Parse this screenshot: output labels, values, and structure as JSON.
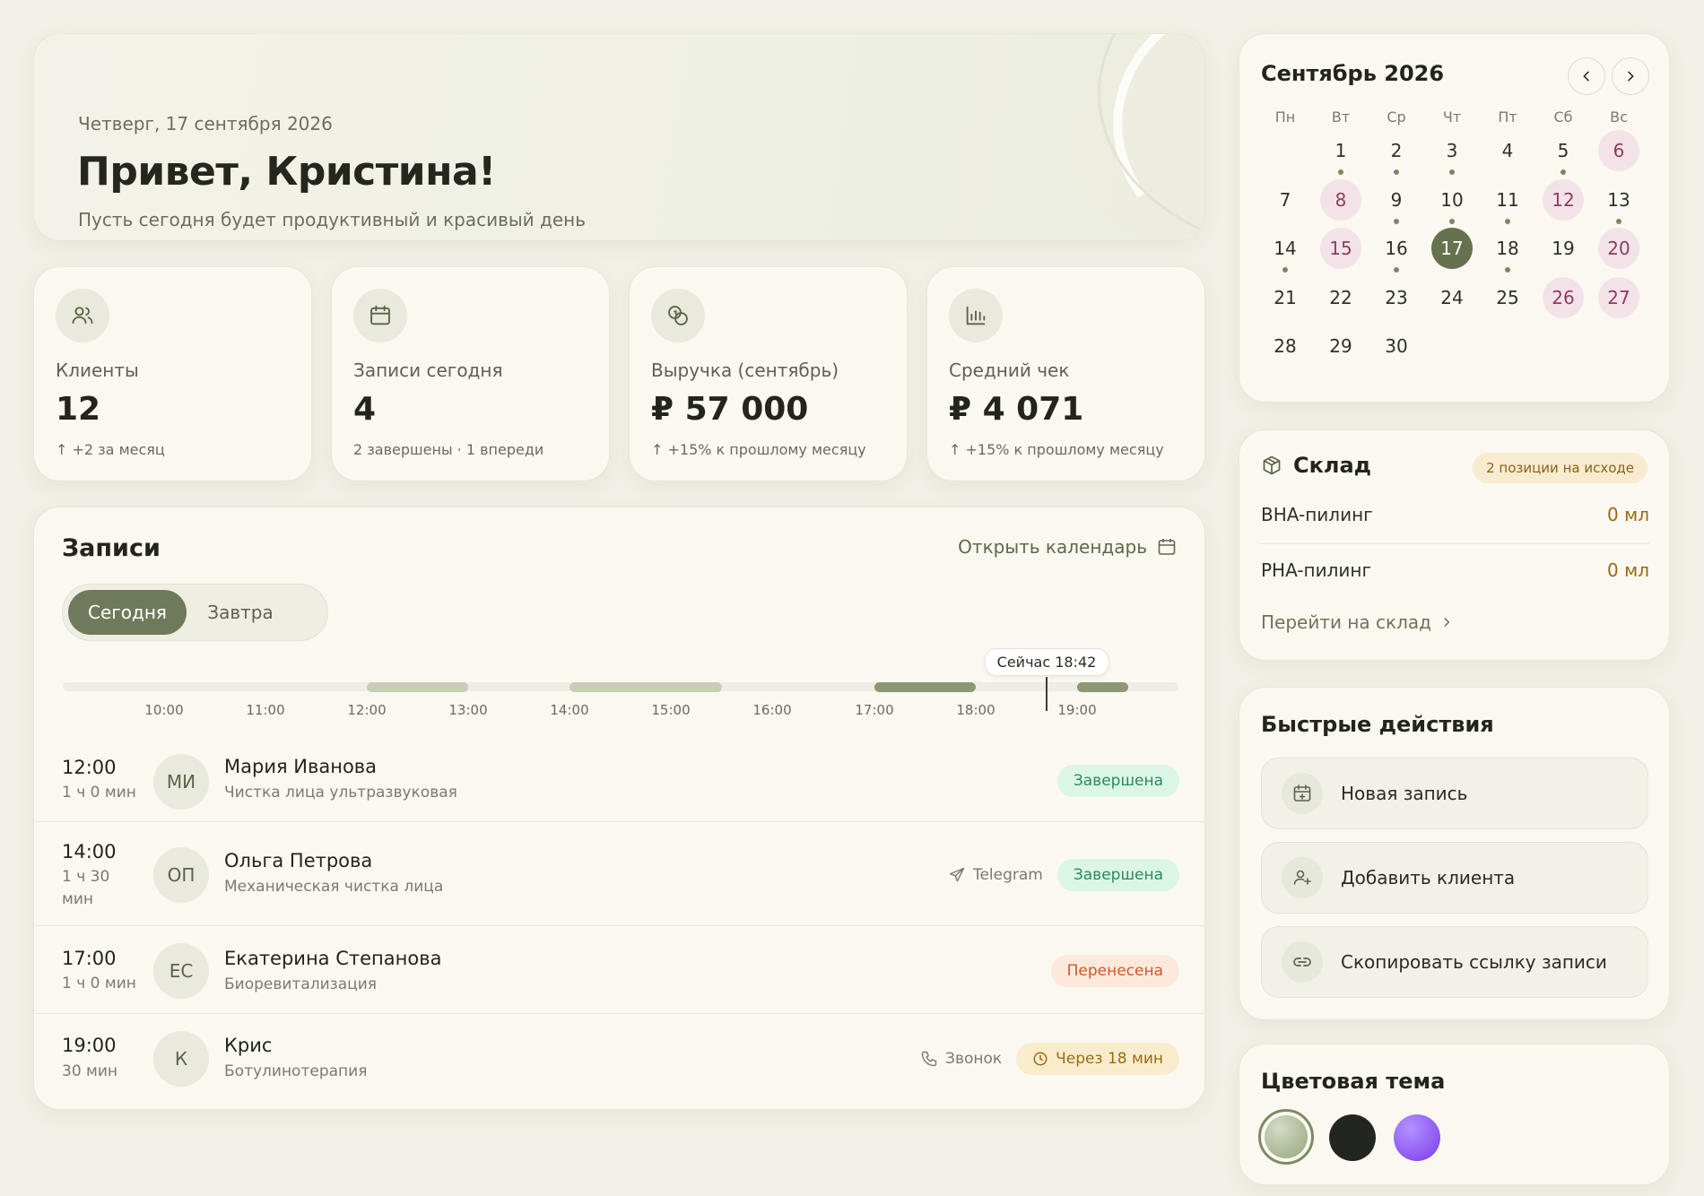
{
  "hero": {
    "date": "Четверг, 17 сентября 2026",
    "greeting": "Привет, Кристина!",
    "subtitle": "Пусть сегодня будет продуктивный и красивый день"
  },
  "stats": [
    {
      "label": "Клиенты",
      "value": "12",
      "sub": "↑ +2 за месяц",
      "icon": "users-icon"
    },
    {
      "label": "Записи сегодня",
      "value": "4",
      "sub": "2 завершены · 1 впереди",
      "icon": "calendar-icon"
    },
    {
      "label": "Выручка (сентябрь)",
      "value": "₽ 57 000",
      "sub": "↑ +15% к прошлому месяцу",
      "icon": "coins-icon"
    },
    {
      "label": "Средний чек",
      "value": "₽ 4 071",
      "sub": "↑ +15% к прошлому месяцу",
      "icon": "bar-chart-icon"
    }
  ],
  "appointments": {
    "title": "Записи",
    "open_calendar": "Открыть календарь",
    "tabs": [
      "Сегодня",
      "Завтра"
    ],
    "active_tab": "Сегодня",
    "timeline": {
      "ticks": [
        "10:00",
        "11:00",
        "12:00",
        "13:00",
        "14:00",
        "15:00",
        "16:00",
        "17:00",
        "18:00",
        "19:00"
      ],
      "now_label": "Сейчас 18:42"
    },
    "items": [
      {
        "time": "12:00",
        "duration": "1 ч 0 мин",
        "initials": "МИ",
        "name": "Мария Иванова",
        "service": "Чистка лица ультразвуковая",
        "channel": "",
        "status": "Завершена"
      },
      {
        "time": "14:00",
        "duration": "1 ч 30 мин",
        "initials": "ОП",
        "name": "Ольга Петрова",
        "service": "Механическая чистка лица",
        "channel": "Telegram",
        "status": "Завершена"
      },
      {
        "time": "17:00",
        "duration": "1 ч 0 мин",
        "initials": "ЕС",
        "name": "Екатерина Степанова",
        "service": "Биоревитализация",
        "channel": "",
        "status": "Перенесена"
      },
      {
        "time": "19:00",
        "duration": "30 мин",
        "initials": "К",
        "name": "Крис",
        "service": "Ботулинотерапия",
        "channel": "Звонок",
        "status": "Через 18 мин"
      }
    ]
  },
  "calendar": {
    "title": "Сентябрь 2026",
    "weekdays": [
      "Пн",
      "Вт",
      "Ср",
      "Чт",
      "Пт",
      "Сб",
      "Вс"
    ],
    "days": [
      "1",
      "2",
      "3",
      "4",
      "5",
      "6",
      "7",
      "8",
      "9",
      "10",
      "11",
      "12",
      "13",
      "14",
      "15",
      "16",
      "17",
      "18",
      "19",
      "20",
      "21",
      "22",
      "23",
      "24",
      "25",
      "26",
      "27",
      "28",
      "29",
      "30"
    ],
    "today": "17"
  },
  "warehouse": {
    "title": "Склад",
    "badge": "2 позиции на исходе",
    "items": [
      {
        "name": "BHA-пилинг",
        "qty": "0 мл"
      },
      {
        "name": "PHA-пилинг",
        "qty": "0 мл"
      }
    ],
    "link": "Перейти на склад"
  },
  "quick_actions": {
    "title": "Быстрые действия",
    "items": [
      "Новая запись",
      "Добавить клиента",
      "Скопировать ссылку записи"
    ]
  },
  "theme": {
    "title": "Цветовая тема",
    "swatches": [
      "#a9b694",
      "#232520",
      "#8b5cf6"
    ]
  },
  "colors": {
    "accent": "#6f7a5a",
    "done": "#2b8c5c",
    "moved": "#d2582a",
    "soon": "#9a6c12"
  }
}
